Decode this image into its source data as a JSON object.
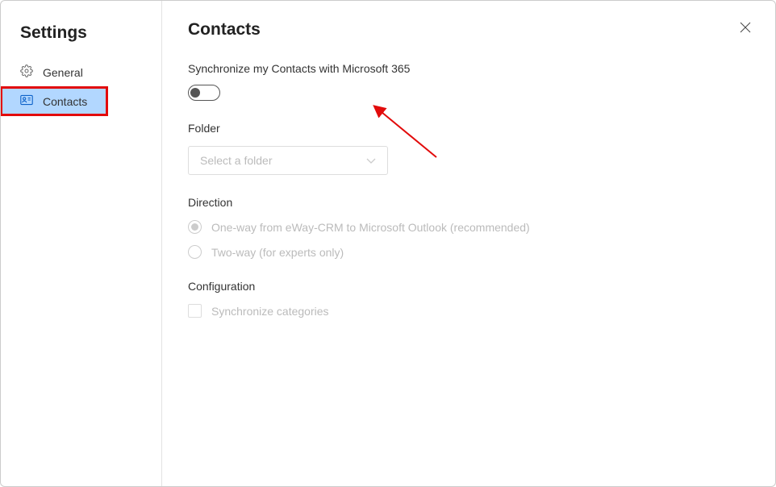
{
  "sidebar": {
    "title": "Settings",
    "items": [
      {
        "label": "General"
      },
      {
        "label": "Contacts"
      }
    ]
  },
  "main": {
    "title": "Contacts",
    "sync_label": "Synchronize my Contacts with Microsoft 365",
    "folder": {
      "heading": "Folder",
      "placeholder": "Select a folder"
    },
    "direction": {
      "heading": "Direction",
      "options": [
        "One-way from eWay-CRM to Microsoft Outlook (recommended)",
        "Two-way (for experts only)"
      ]
    },
    "configuration": {
      "heading": "Configuration",
      "options": [
        "Synchronize categories"
      ]
    }
  }
}
